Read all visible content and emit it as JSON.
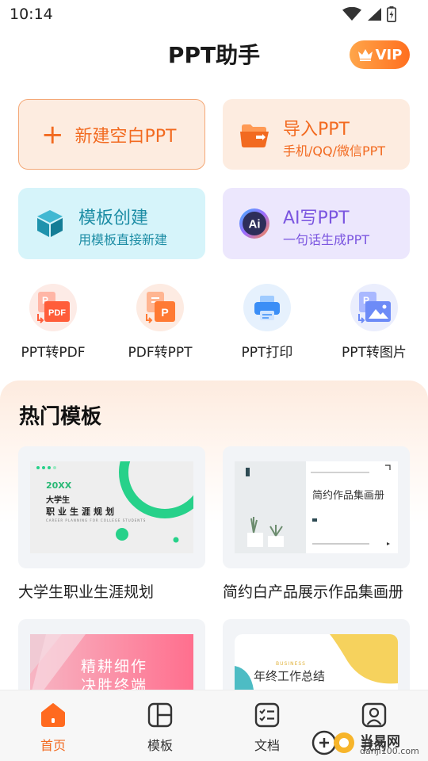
{
  "status_bar": {
    "time": "10:14"
  },
  "header": {
    "title": "PPT助手",
    "vip_label": "VIP"
  },
  "actions": {
    "new_blank": {
      "label": "新建空白PPT"
    },
    "import": {
      "title": "导入PPT",
      "subtitle": "手机/QQ/微信PPT"
    },
    "template_create": {
      "title": "模板创建",
      "subtitle": "用模板直接新建"
    },
    "ai_write": {
      "title": "AI写PPT",
      "subtitle": "一句话生成PPT",
      "icon_text": "Ai"
    }
  },
  "tools": [
    {
      "label": "PPT转PDF",
      "icon_text": "PDF"
    },
    {
      "label": "PDF转PPT",
      "icon_text": "P"
    },
    {
      "label": "PPT打印"
    },
    {
      "label": "PPT转图片"
    }
  ],
  "hot_templates": {
    "title": "热门模板",
    "items": [
      {
        "title": "大学生职业生涯规划",
        "thumb": {
          "year": "20XX",
          "line1": "大学生",
          "line2": "职业生涯规划",
          "eng": "CAREER PLANNING FOR COLLEGE STUDENTS"
        }
      },
      {
        "title": "简约白产品展示作品集画册",
        "thumb": {
          "heading": "简约作品集画册"
        }
      },
      {
        "title": "",
        "thumb": {
          "line1": "精耕细作",
          "line2": "决胜终端"
        }
      },
      {
        "title": "",
        "thumb": {
          "tag": "BUSINESS",
          "heading": "年终工作总结"
        }
      }
    ]
  },
  "bottom_nav": {
    "items": [
      {
        "label": "首页",
        "active": true
      },
      {
        "label": "模板"
      },
      {
        "label": "文档"
      },
      {
        "label": "我的"
      }
    ]
  },
  "watermark": {
    "text": "当易网",
    "url": "danji100.com"
  },
  "colors": {
    "accent_orange": "#f26a20",
    "teal": "#1d8da5",
    "purple": "#7b56e0",
    "green": "#27d18a"
  }
}
